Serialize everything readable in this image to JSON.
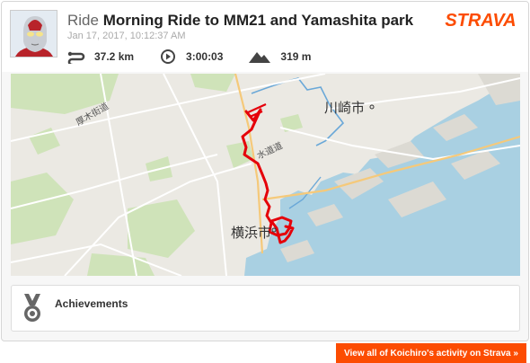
{
  "activity": {
    "type": "Ride",
    "name": "Morning Ride to MM21 and Yamashita park",
    "date": "Jan 17, 2017, 10:12:37 AM",
    "stats": {
      "distance": "37.2 km",
      "moving_time": "3:00:03",
      "elevation": "319 m"
    },
    "icons": {
      "distance": "distance-icon",
      "time": "clock-icon",
      "elevation": "elevation-icon"
    }
  },
  "brand": {
    "logo_text": "STRAVA",
    "accent": "#fc4c02"
  },
  "map": {
    "labels": {
      "kawasaki": "川崎市",
      "yokohama": "横浜市",
      "road_1": "厚木街道",
      "road_2": "水道道"
    },
    "route_color": "#e5000a",
    "water_color": "#aad3df"
  },
  "achievements": {
    "label": "Achievements",
    "icon": "medal-icon"
  },
  "footer": {
    "view_all": "View all of Koichiro's activity on Strava »"
  }
}
